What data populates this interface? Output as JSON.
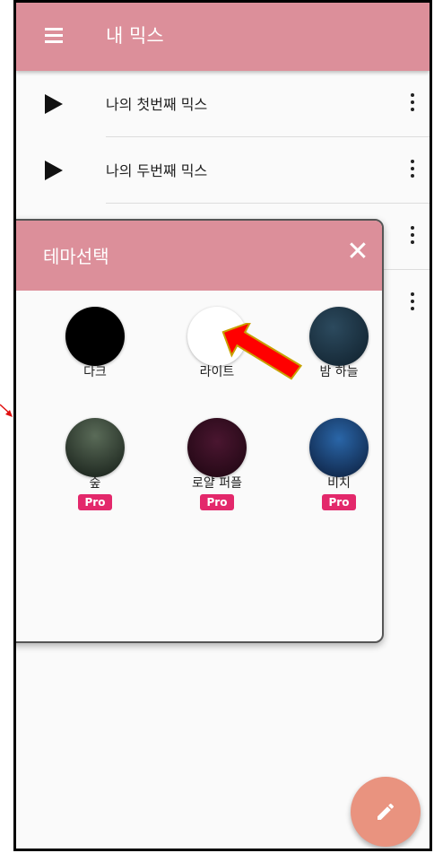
{
  "app_bar": {
    "title": "내 믹스",
    "menu_icon": "menu-icon"
  },
  "mixes": [
    {
      "label": "나의 첫번째 믹스"
    },
    {
      "label": "나의 두번째 믹스"
    },
    {
      "label": ""
    },
    {
      "label": ""
    }
  ],
  "theme_dialog": {
    "title": "테마선택",
    "close_icon": "close-icon",
    "themes": [
      {
        "name": "다크",
        "pro": false,
        "color": "#000000"
      },
      {
        "name": "라이트",
        "pro": false,
        "color": "#ffffff"
      },
      {
        "name": "밤 하늘",
        "pro": false,
        "color": "#1c3444"
      },
      {
        "name": "숲",
        "pro": true,
        "color": "#2c3b31"
      },
      {
        "name": "로얄 퍼플",
        "pro": true,
        "color": "#3a0f24"
      },
      {
        "name": "비치",
        "pro": true,
        "color": "#153a6a"
      }
    ],
    "pro_label": "Pro"
  },
  "fab": {
    "icon": "pencil-icon"
  },
  "colors": {
    "accent": "#dc8f9a",
    "fab": "#e9937f",
    "pro_badge": "#e3286b"
  }
}
